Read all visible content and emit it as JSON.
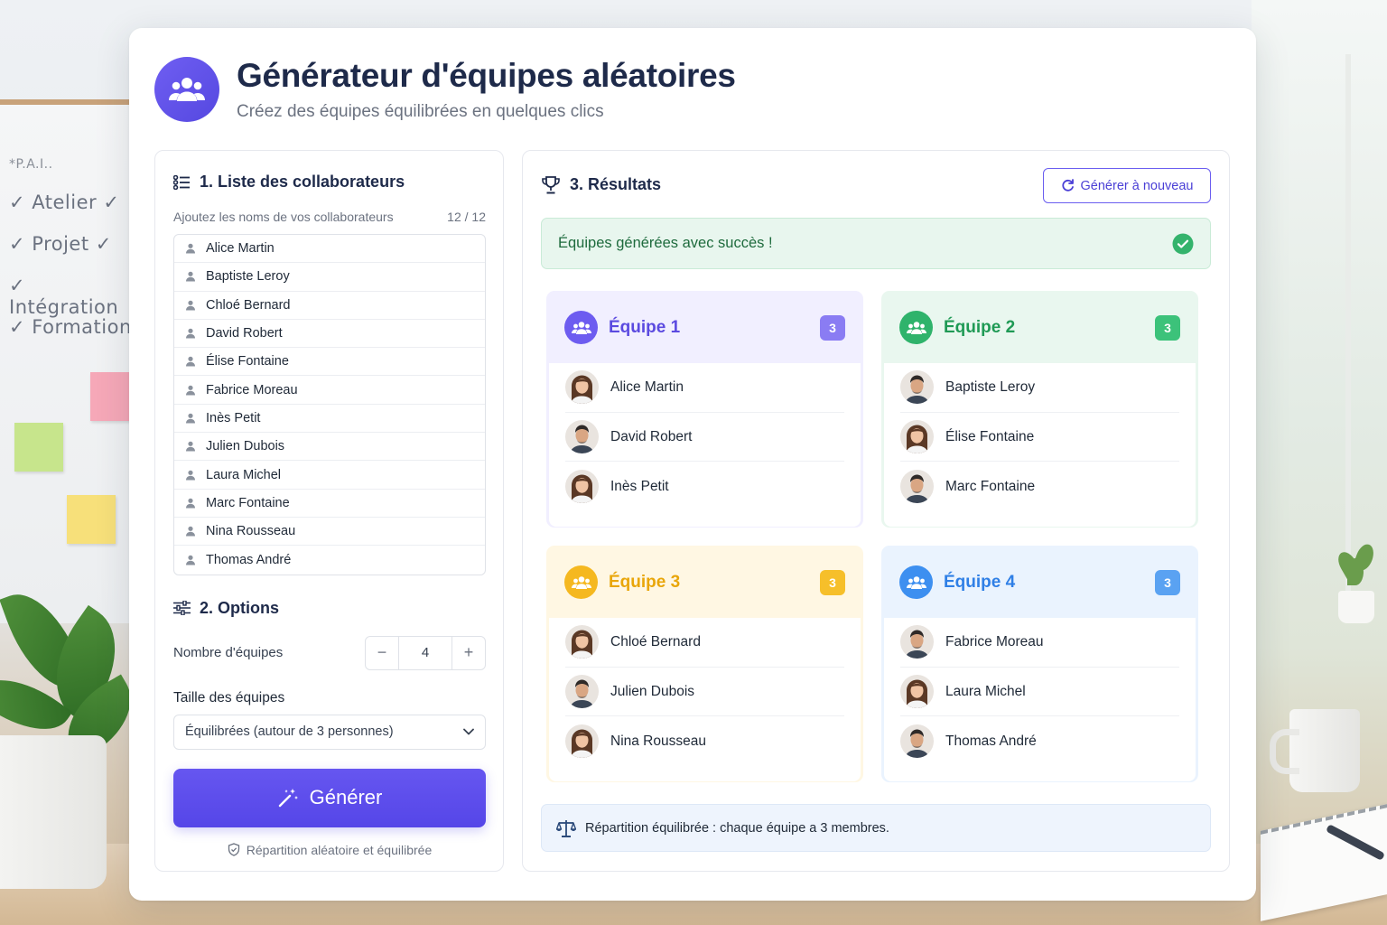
{
  "background": {
    "board_notes": [
      "✓ Atelier ✓",
      "✓ Projet ✓",
      "✓ Intégration",
      "✓ Formation"
    ],
    "board_scribble": "*P.A.I.."
  },
  "header": {
    "title": "Générateur d'équipes aléatoires",
    "subtitle": "Créez des équipes équilibrées en quelques clics",
    "logo_icon": "users-icon"
  },
  "collaborators": {
    "title": "1. Liste des collaborateurs",
    "hint": "Ajoutez les noms de vos collaborateurs",
    "count": "12 / 12",
    "names": [
      {
        "name": "Alice Martin",
        "bold": true
      },
      {
        "name": "Baptiste Leroy",
        "bold": false
      },
      {
        "name": "Chloé Bernard",
        "bold": false
      },
      {
        "name": "David Robert",
        "bold": false
      },
      {
        "name": "Élise Fontaine",
        "bold": false
      },
      {
        "name": "Fabrice Moreau",
        "bold": true
      },
      {
        "name": "Inès Petit",
        "bold": false
      },
      {
        "name": "Julien Dubois",
        "bold": false
      },
      {
        "name": "Laura Michel",
        "bold": false
      },
      {
        "name": "Marc Fontaine",
        "bold": false
      },
      {
        "name": "Nina Rousseau",
        "bold": false
      },
      {
        "name": "Thomas André",
        "bold": true
      }
    ]
  },
  "options": {
    "title": "2. Options",
    "teams_label": "Nombre d'équipes",
    "teams_value": "4",
    "minus": "−",
    "plus": "+",
    "size_label": "Taille des équipes",
    "size_value": "Équilibrées (autour de 3 personnes)",
    "generate_label": "Générer",
    "footnote": "Répartition aléatoire et équilibrée"
  },
  "results": {
    "title": "3. Résultats",
    "regenerate_label": "Générer à nouveau",
    "success_message": "Équipes générées avec succès !",
    "info": "Répartition équilibrée : chaque équipe a 3 membres.",
    "teams": [
      {
        "name": "Équipe 1",
        "count": "3",
        "accent": "#6d5cf0",
        "tint": "#f1efff",
        "text": "#5b4ae0",
        "badge": "#8a7cf3",
        "members": [
          {
            "name": "Alice Martin",
            "avatar": "f"
          },
          {
            "name": "David Robert",
            "avatar": "m"
          },
          {
            "name": "Inès Petit",
            "avatar": "f"
          }
        ]
      },
      {
        "name": "Équipe 2",
        "count": "3",
        "accent": "#2fb36b",
        "tint": "#e9f7ef",
        "text": "#1f9a55",
        "badge": "#3cc27a",
        "members": [
          {
            "name": "Baptiste Leroy",
            "avatar": "m"
          },
          {
            "name": "Élise Fontaine",
            "avatar": "f"
          },
          {
            "name": "Marc Fontaine",
            "avatar": "m"
          }
        ]
      },
      {
        "name": "Équipe 3",
        "count": "3",
        "accent": "#f5b820",
        "tint": "#fff7e3",
        "text": "#e9a60a",
        "badge": "#f6bf2a",
        "members": [
          {
            "name": "Chloé Bernard",
            "avatar": "f"
          },
          {
            "name": "Julien Dubois",
            "avatar": "m"
          },
          {
            "name": "Nina Rousseau",
            "avatar": "f"
          }
        ]
      },
      {
        "name": "Équipe 4",
        "count": "3",
        "accent": "#3d8ff0",
        "tint": "#eaf3fe",
        "text": "#2f7fe6",
        "badge": "#5aa2f2",
        "members": [
          {
            "name": "Fabrice Moreau",
            "avatar": "m"
          },
          {
            "name": "Laura Michel",
            "avatar": "f"
          },
          {
            "name": "Thomas André",
            "avatar": "m"
          }
        ]
      }
    ]
  }
}
